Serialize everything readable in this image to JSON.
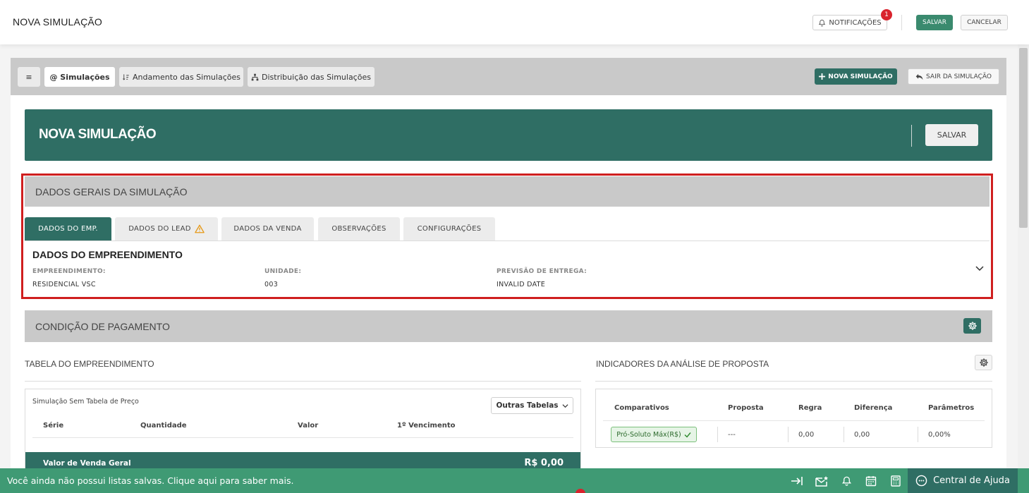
{
  "topbar": {
    "title": "NOVA SIMULAÇÃO",
    "notifications_label": "NOTIFICAÇÕES",
    "notifications_count": "1",
    "save_label": "SALVAR",
    "cancel_label": "CANCELAR"
  },
  "nav": {
    "menu_glyph": "≡",
    "tabs": [
      {
        "label": "@ Simulações",
        "active": true
      },
      {
        "label": "Andamento das Simulações",
        "active": false
      },
      {
        "label": "Distribuição das Simulações",
        "active": false
      }
    ],
    "new_sim_label": "NOVA SIMULAÇÃO",
    "exit_label": "SAIR DA SIMULAÇÃO"
  },
  "hero": {
    "title": "NOVA SIMULAÇÃO",
    "save_label": "SALVAR"
  },
  "dados_gerais": {
    "header": "DADOS GERAIS DA SIMULAÇÃO",
    "tabs": [
      {
        "label": "DADOS DO EMP.",
        "active": true
      },
      {
        "label": "DADOS DO LEAD",
        "active": false,
        "warning": true
      },
      {
        "label": "DADOS DA VENDA",
        "active": false
      },
      {
        "label": "OBSERVAÇÕES",
        "active": false
      },
      {
        "label": "CONFIGURAÇÕES",
        "active": false
      }
    ],
    "section_title": "DADOS DO EMPREENDIMENTO",
    "fields": [
      {
        "label": "EMPREENDIMENTO:",
        "value": "RESIDENCIAL VSC"
      },
      {
        "label": "UNIDADE:",
        "value": "003"
      },
      {
        "label": "PREVISÃO DE ENTREGA:",
        "value": "INVALID DATE"
      }
    ]
  },
  "pagamento": {
    "header": "CONDIÇÃO DE PAGAMENTO",
    "tabela_title": "TABELA DO EMPREENDIMENTO",
    "indicadores_title": "INDICADORES DA ANÁLISE DE PROPOSTA",
    "tabela": {
      "caption": "Simulação Sem Tabela de Preço",
      "outras_label": "Outras Tabelas",
      "columns": [
        "Série",
        "Quantidade",
        "Valor",
        "1º Vencimento"
      ],
      "venda_label": "Valor de Venda Geral",
      "venda_value": "R$ 0,00"
    },
    "indicadores": {
      "columns": [
        "Comparativos",
        "Proposta",
        "Regra",
        "Diferença",
        "Parâmetros"
      ],
      "row": {
        "comparativo": "Pró-Soluto Máx(R$)",
        "proposta": "---",
        "regra": "0,00",
        "diferenca": "0,00",
        "parametros": "0,00%"
      }
    }
  },
  "bottombar": {
    "message": "Você ainda não possui listas salvas. Clique aqui para saber mais.",
    "help_label": "Central de Ajuda"
  },
  "colors": {
    "primary": "#2f6e64",
    "bottom_bar": "#3f9a74",
    "highlight": "#cf1f1f",
    "badge": "#d9232d"
  }
}
